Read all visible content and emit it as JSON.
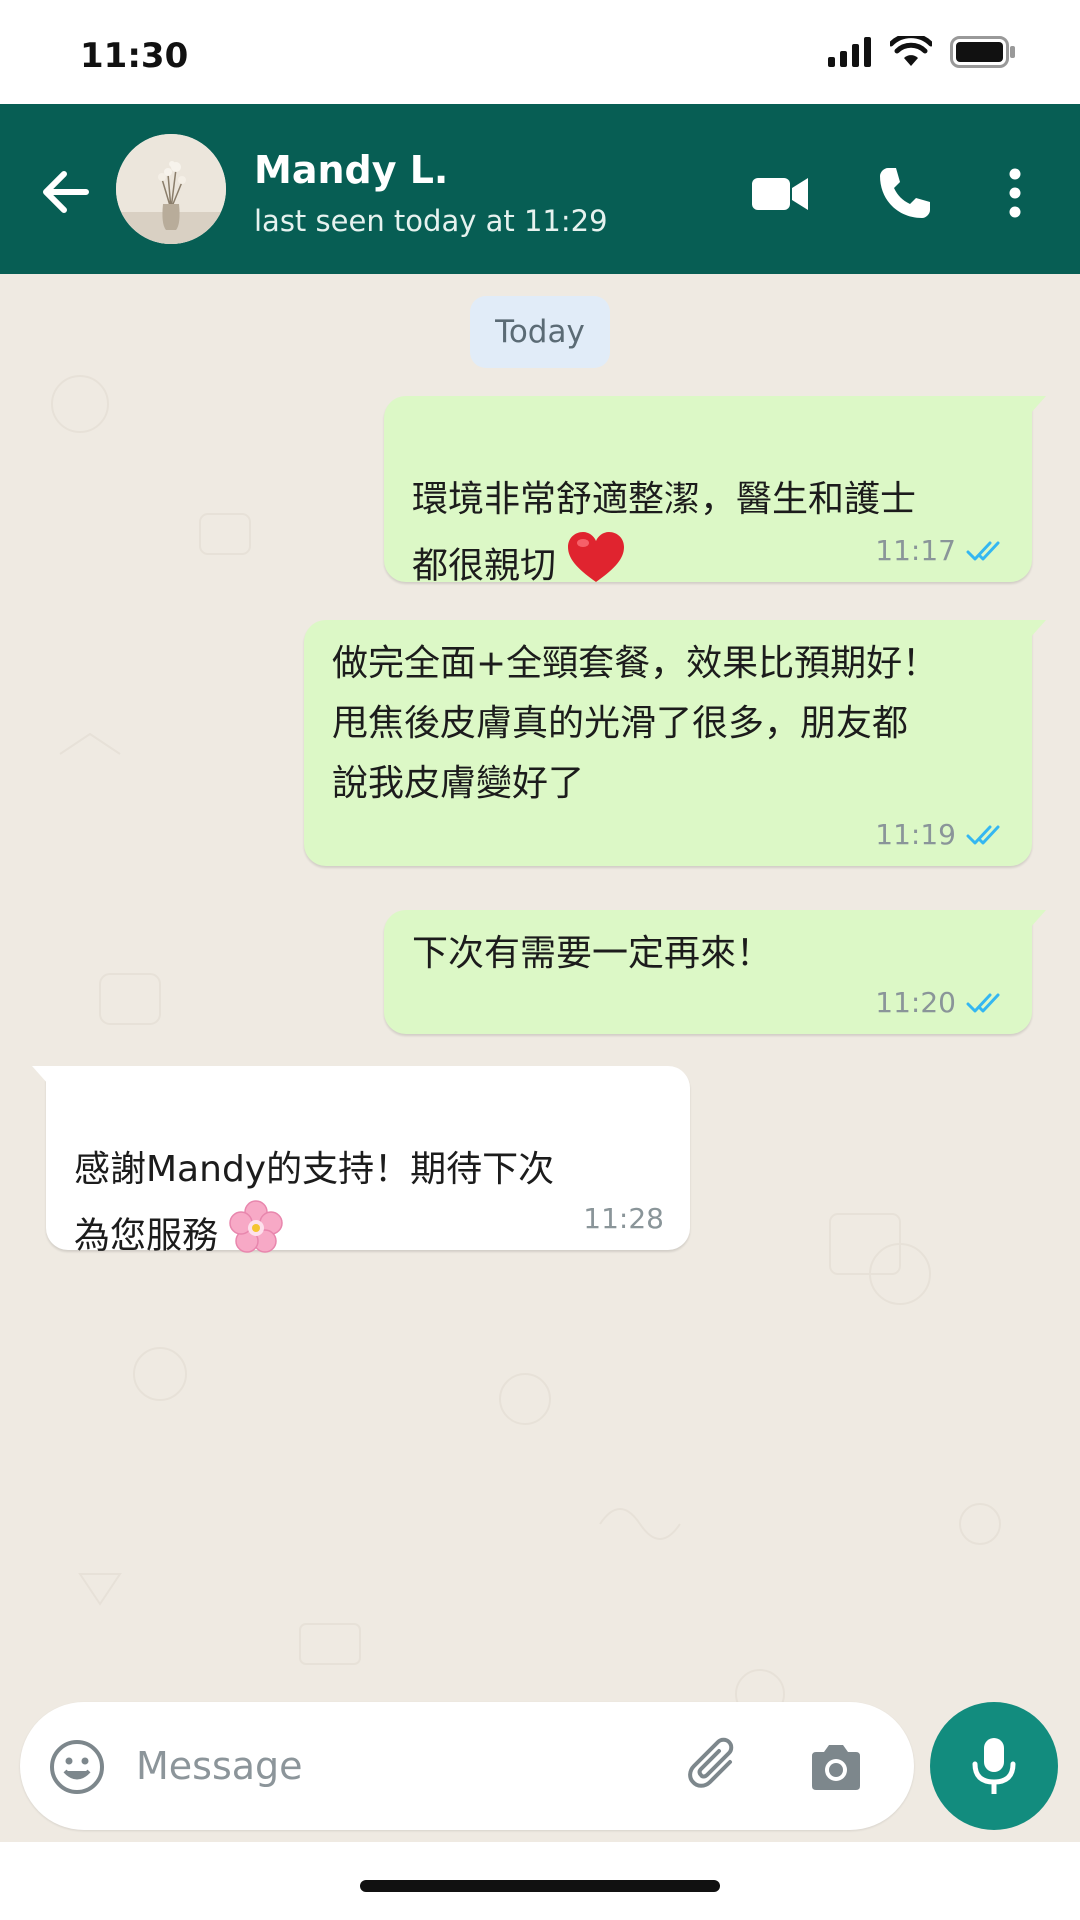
{
  "status_bar": {
    "time": "11:30"
  },
  "header": {
    "contact_name": "Mandy L.",
    "contact_status": "last seen today at 11:29",
    "icons": [
      "back-arrow-icon",
      "video-call-icon",
      "phone-icon",
      "more-vert-icon"
    ]
  },
  "chat": {
    "date_label": "Today",
    "messages": [
      {
        "direction": "outgoing",
        "text": "環境非常舒適整潔，醫生和護士\n都很親切",
        "emoji": "red-heart",
        "time": "11:17",
        "status": "read"
      },
      {
        "direction": "outgoing",
        "text": "做完全面+全頸套餐，效果比預期好！\n甩焦後皮膚真的光滑了很多，朋友都\n說我皮膚變好了",
        "time": "11:19",
        "status": "read"
      },
      {
        "direction": "outgoing",
        "text": "下次有需要一定再來！",
        "time": "11:20",
        "status": "read"
      },
      {
        "direction": "incoming",
        "text": "感謝Mandy的支持！期待下次\n為您服務",
        "emoji": "cherry-blossom",
        "time": "11:28"
      }
    ]
  },
  "input": {
    "placeholder": "Message",
    "value": ""
  },
  "colors": {
    "header": "#075e54",
    "chat_bg": "#efeae2",
    "outgoing_bubble": "#dcf8c6",
    "incoming_bubble": "#ffffff",
    "read_ticks": "#34b7f1",
    "mic_button": "#128c7e"
  }
}
